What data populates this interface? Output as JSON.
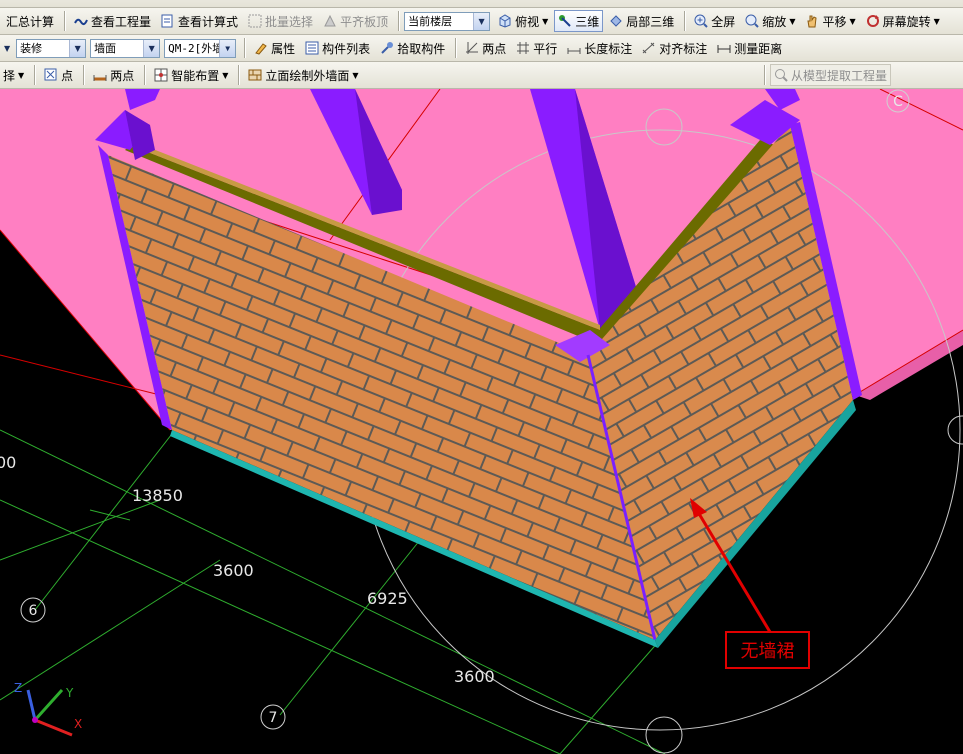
{
  "toolbar_top": {
    "items": [
      "",
      "",
      "",
      "",
      ""
    ]
  },
  "toolbar1": {
    "summary_calc": "汇总计算",
    "view_quantity": "查看工程量",
    "view_formula": "查看计算式",
    "batch_select": "批量选择",
    "align_slab_top": "平齐板顶",
    "floor_select": "当前楼层",
    "top_view": "俯视",
    "three_d": "三维",
    "local_3d": "局部三维",
    "full_screen": "全屏",
    "zoom": "缩放",
    "pan": "平移",
    "screen_rotate": "屏幕旋转"
  },
  "toolbar2": {
    "category_select": "装修",
    "type_select": "墙面",
    "component_select": "QM-2[外墙",
    "properties": "属性",
    "component_list": "构件列表",
    "pick_component": "拾取构件",
    "two_points": "两点",
    "parallel": "平行",
    "length_dim": "长度标注",
    "align_dim": "对齐标注",
    "measure_distance": "测量距离"
  },
  "toolbar3": {
    "select_partial": "择",
    "point": "点",
    "two_points": "两点",
    "smart_layout": "智能布置",
    "elevation_draw": "立面绘制外墙面",
    "extract_quantity": "从模型提取工程量"
  },
  "viewport": {
    "dimensions": [
      "13850",
      "3600",
      "6925",
      "3600",
      "00"
    ],
    "axis_labels": [
      "6",
      "7",
      "C"
    ],
    "axes_triad": [
      "Z",
      "Y",
      "X"
    ],
    "annotation": "无墙裙"
  },
  "colors": {
    "slab": "#ff7fc2",
    "column": "#8a1cff",
    "brick": "#d9884a",
    "base": "#1fb6b0",
    "grid": "#2fae2f",
    "annotation": "#e10000"
  }
}
